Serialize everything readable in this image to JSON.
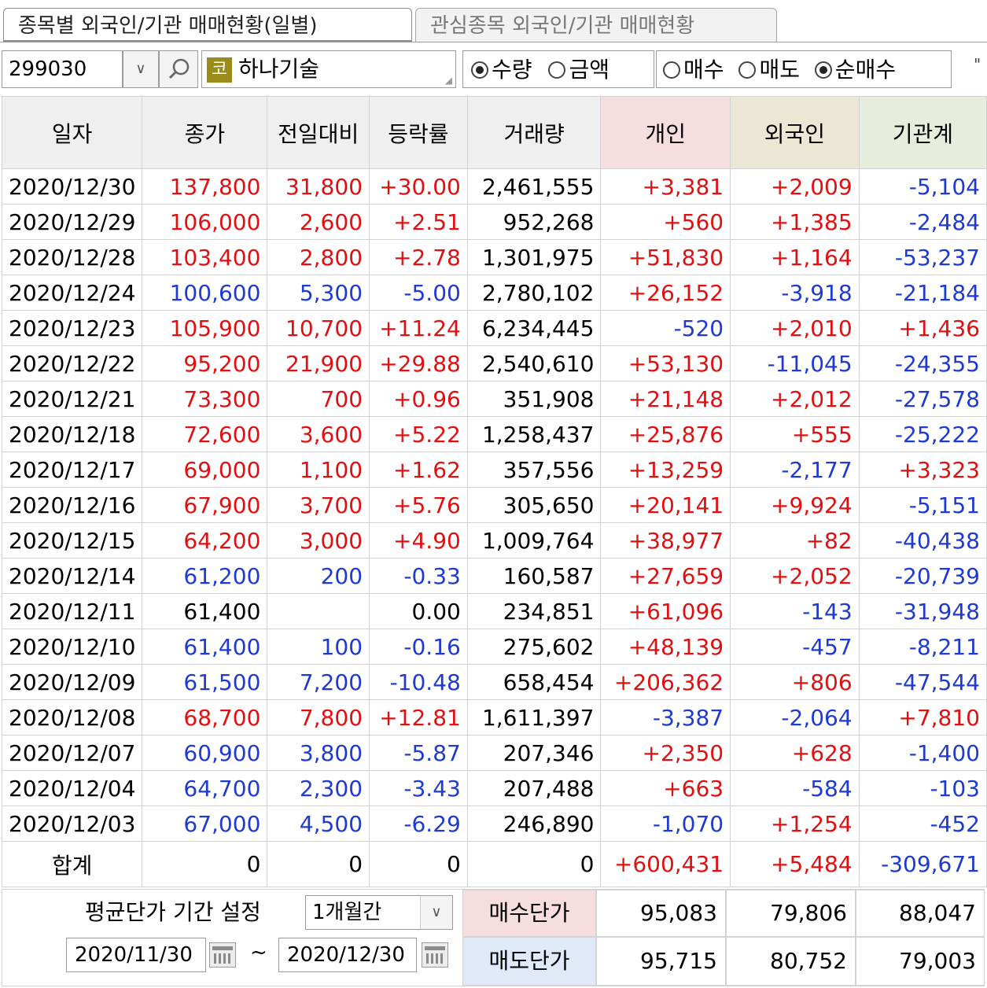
{
  "tabs": [
    "종목별 외국인/기관 매매현황(일별)",
    "관심종목 외국인/기관 매매현황"
  ],
  "toolbar": {
    "code": "299030",
    "market_badge": "코",
    "stock_name": "하나기술",
    "unit_options": [
      {
        "label": "수량",
        "checked": true
      },
      {
        "label": "금액",
        "checked": false
      }
    ],
    "trade_options": [
      {
        "label": "매수",
        "checked": false
      },
      {
        "label": "매도",
        "checked": false
      },
      {
        "label": "순매수",
        "checked": true
      }
    ],
    "overflow": "\""
  },
  "columns": [
    "일자",
    "종가",
    "전일대비",
    "등락률",
    "거래량",
    "개인",
    "외국인",
    "기관계"
  ],
  "rows": [
    {
      "date": "2020/12/30",
      "close": "137,800",
      "change": "31,800",
      "rate": "+30.00",
      "volume": "2,461,555",
      "indiv": "+3,381",
      "foreign": "+2,009",
      "inst": "-5,104",
      "dir": "up"
    },
    {
      "date": "2020/12/29",
      "close": "106,000",
      "change": "2,600",
      "rate": "+2.51",
      "volume": "952,268",
      "indiv": "+560",
      "foreign": "+1,385",
      "inst": "-2,484",
      "dir": "up"
    },
    {
      "date": "2020/12/28",
      "close": "103,400",
      "change": "2,800",
      "rate": "+2.78",
      "volume": "1,301,975",
      "indiv": "+51,830",
      "foreign": "+1,164",
      "inst": "-53,237",
      "dir": "up"
    },
    {
      "date": "2020/12/24",
      "close": "100,600",
      "change": "5,300",
      "rate": "-5.00",
      "volume": "2,780,102",
      "indiv": "+26,152",
      "foreign": "-3,918",
      "inst": "-21,184",
      "dir": "down"
    },
    {
      "date": "2020/12/23",
      "close": "105,900",
      "change": "10,700",
      "rate": "+11.24",
      "volume": "6,234,445",
      "indiv": "-520",
      "foreign": "+2,010",
      "inst": "+1,436",
      "dir": "up"
    },
    {
      "date": "2020/12/22",
      "close": "95,200",
      "change": "21,900",
      "rate": "+29.88",
      "volume": "2,540,610",
      "indiv": "+53,130",
      "foreign": "-11,045",
      "inst": "-24,355",
      "dir": "up"
    },
    {
      "date": "2020/12/21",
      "close": "73,300",
      "change": "700",
      "rate": "+0.96",
      "volume": "351,908",
      "indiv": "+21,148",
      "foreign": "+2,012",
      "inst": "-27,578",
      "dir": "up"
    },
    {
      "date": "2020/12/18",
      "close": "72,600",
      "change": "3,600",
      "rate": "+5.22",
      "volume": "1,258,437",
      "indiv": "+25,876",
      "foreign": "+555",
      "inst": "-25,222",
      "dir": "up"
    },
    {
      "date": "2020/12/17",
      "close": "69,000",
      "change": "1,100",
      "rate": "+1.62",
      "volume": "357,556",
      "indiv": "+13,259",
      "foreign": "-2,177",
      "inst": "+3,323",
      "dir": "up"
    },
    {
      "date": "2020/12/16",
      "close": "67,900",
      "change": "3,700",
      "rate": "+5.76",
      "volume": "305,650",
      "indiv": "+20,141",
      "foreign": "+9,924",
      "inst": "-5,151",
      "dir": "up"
    },
    {
      "date": "2020/12/15",
      "close": "64,200",
      "change": "3,000",
      "rate": "+4.90",
      "volume": "1,009,764",
      "indiv": "+38,977",
      "foreign": "+82",
      "inst": "-40,438",
      "dir": "up"
    },
    {
      "date": "2020/12/14",
      "close": "61,200",
      "change": "200",
      "rate": "-0.33",
      "volume": "160,587",
      "indiv": "+27,659",
      "foreign": "+2,052",
      "inst": "-20,739",
      "dir": "down"
    },
    {
      "date": "2020/12/11",
      "close": "61,400",
      "change": "",
      "rate": "0.00",
      "volume": "234,851",
      "indiv": "+61,096",
      "foreign": "-143",
      "inst": "-31,948",
      "dir": "flat"
    },
    {
      "date": "2020/12/10",
      "close": "61,400",
      "change": "100",
      "rate": "-0.16",
      "volume": "275,602",
      "indiv": "+48,139",
      "foreign": "-457",
      "inst": "-8,211",
      "dir": "down"
    },
    {
      "date": "2020/12/09",
      "close": "61,500",
      "change": "7,200",
      "rate": "-10.48",
      "volume": "658,454",
      "indiv": "+206,362",
      "foreign": "+806",
      "inst": "-47,544",
      "dir": "down"
    },
    {
      "date": "2020/12/08",
      "close": "68,700",
      "change": "7,800",
      "rate": "+12.81",
      "volume": "1,611,397",
      "indiv": "-3,387",
      "foreign": "-2,064",
      "inst": "+7,810",
      "dir": "up"
    },
    {
      "date": "2020/12/07",
      "close": "60,900",
      "change": "3,800",
      "rate": "-5.87",
      "volume": "207,346",
      "indiv": "+2,350",
      "foreign": "+628",
      "inst": "-1,400",
      "dir": "down"
    },
    {
      "date": "2020/12/04",
      "close": "64,700",
      "change": "2,300",
      "rate": "-3.43",
      "volume": "207,488",
      "indiv": "+663",
      "foreign": "-584",
      "inst": "-103",
      "dir": "down"
    },
    {
      "date": "2020/12/03",
      "close": "67,000",
      "change": "4,500",
      "rate": "-6.29",
      "volume": "246,890",
      "indiv": "-1,070",
      "foreign": "+1,254",
      "inst": "-452",
      "dir": "down"
    }
  ],
  "total": {
    "label": "합계",
    "close": "0",
    "change": "0",
    "rate": "0",
    "volume": "0",
    "indiv": "+600,431",
    "foreign": "+5,484",
    "inst": "-309,671"
  },
  "avg_price": {
    "period_label": "평균단가 기간 설정",
    "period_value": "1개월간",
    "from_date": "2020/11/30",
    "separator": "~",
    "to_date": "2020/12/30",
    "buy_label": "매수단가",
    "sell_label": "매도단가",
    "buy": {
      "indiv": "95,083",
      "foreign": "79,806",
      "inst": "88,047"
    },
    "sell": {
      "indiv": "95,715",
      "foreign": "80,752",
      "inst": "79,003"
    }
  },
  "colors": {
    "up": "#e01010",
    "down": "#1e3ad0",
    "flat": "#000000",
    "buy_bg": "#f7dede",
    "sell_bg": "#dfe9f7"
  }
}
